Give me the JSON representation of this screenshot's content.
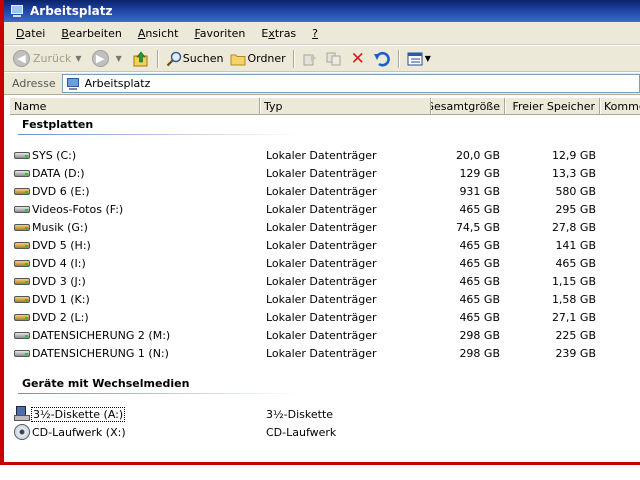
{
  "window": {
    "title": "Arbeitsplatz"
  },
  "menu": [
    {
      "label": "Datei"
    },
    {
      "label": "Bearbeiten"
    },
    {
      "label": "Ansicht"
    },
    {
      "label": "Favoriten"
    },
    {
      "label": "Extras"
    },
    {
      "label": "?"
    }
  ],
  "toolbar": {
    "back_label": "Zurück",
    "search_label": "Suchen",
    "folders_label": "Ordner"
  },
  "address": {
    "label": "Adresse",
    "value": "Arbeitsplatz"
  },
  "columns": [
    "Name",
    "Typ",
    "Gesamtgröße",
    "Freier Speicher",
    "Kommentar"
  ],
  "groups": [
    {
      "heading": "Festplatten",
      "items": [
        {
          "name": "SYS (C:)",
          "type": "Lokaler Datenträger",
          "total": "20,0 GB",
          "free": "12,9 GB",
          "icon": "hard-drive-icon"
        },
        {
          "name": "DATA (D:)",
          "type": "Lokaler Datenträger",
          "total": "129 GB",
          "free": "13,3 GB",
          "icon": "hard-drive-icon"
        },
        {
          "name": "DVD 6 (E:)",
          "type": "Lokaler Datenträger",
          "total": "931 GB",
          "free": "580 GB",
          "icon": "music-drive-icon"
        },
        {
          "name": "Videos-Fotos (F:)",
          "type": "Lokaler Datenträger",
          "total": "465 GB",
          "free": "295 GB",
          "icon": "hard-drive-icon"
        },
        {
          "name": "Musik (G:)",
          "type": "Lokaler Datenträger",
          "total": "74,5 GB",
          "free": "27,8 GB",
          "icon": "music-drive-icon"
        },
        {
          "name": "DVD 5 (H:)",
          "type": "Lokaler Datenträger",
          "total": "465 GB",
          "free": "141 GB",
          "icon": "music-drive-icon"
        },
        {
          "name": "DVD 4 (I:)",
          "type": "Lokaler Datenträger",
          "total": "465 GB",
          "free": "465 GB",
          "icon": "music-drive-icon"
        },
        {
          "name": "DVD 3 (J:)",
          "type": "Lokaler Datenträger",
          "total": "465 GB",
          "free": "1,15 GB",
          "icon": "music-drive-icon"
        },
        {
          "name": "DVD 1 (K:)",
          "type": "Lokaler Datenträger",
          "total": "465 GB",
          "free": "1,58 GB",
          "icon": "music-drive-icon"
        },
        {
          "name": "DVD 2 (L:)",
          "type": "Lokaler Datenträger",
          "total": "465 GB",
          "free": "27,1 GB",
          "icon": "music-drive-icon"
        },
        {
          "name": "DATENSICHERUNG 2 (M:)",
          "type": "Lokaler Datenträger",
          "total": "298 GB",
          "free": "225 GB",
          "icon": "hard-drive-icon"
        },
        {
          "name": "DATENSICHERUNG 1 (N:)",
          "type": "Lokaler Datenträger",
          "total": "298 GB",
          "free": "239 GB",
          "icon": "hard-drive-icon"
        }
      ]
    },
    {
      "heading": "Geräte mit Wechselmedien",
      "items": [
        {
          "name": "3½-Diskette (A:)",
          "type": "3½-Diskette",
          "total": "",
          "free": "",
          "icon": "floppy-icon"
        },
        {
          "name": "CD-Laufwerk (X:)",
          "type": "CD-Laufwerk",
          "total": "",
          "free": "",
          "icon": "cd-drive-icon"
        }
      ]
    }
  ],
  "colors": {
    "titlebar": "#0a246a",
    "chrome": "#ece9d8",
    "border_accent": "#c80000"
  }
}
